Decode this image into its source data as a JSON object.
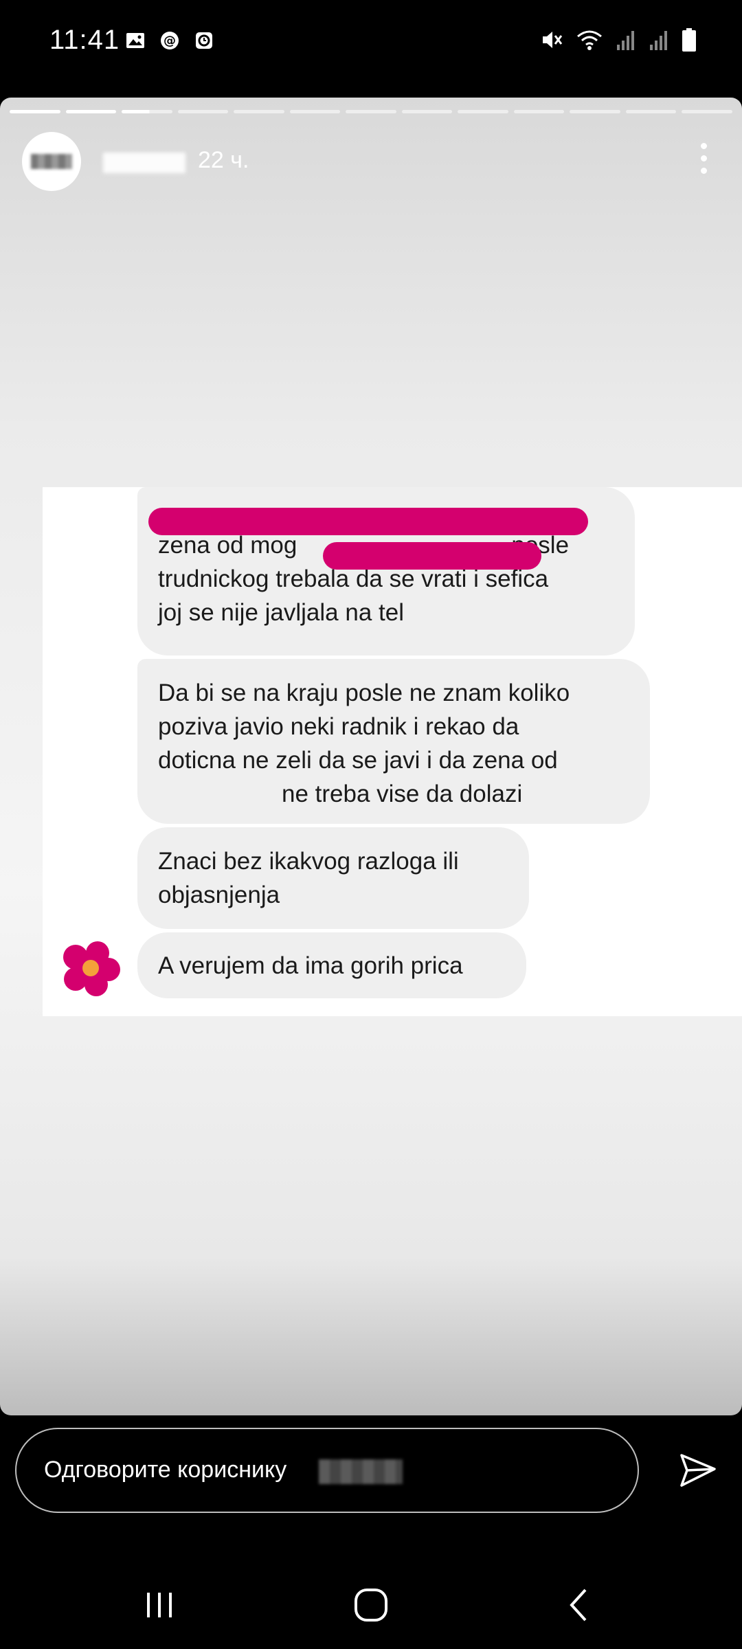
{
  "status_bar": {
    "time": "11:41",
    "left_icons": [
      "image-icon",
      "at-sign-icon",
      "clock-app-icon"
    ],
    "right_icons": [
      "mute-icon",
      "wifi-icon",
      "signal-icon",
      "signal-icon",
      "battery-icon"
    ]
  },
  "story": {
    "segments_total": 13,
    "segments_done": 2,
    "current_segment": 3,
    "time_ago": "22 ч."
  },
  "chat": {
    "messages": [
      {
        "lines": [
          "zena od mog",
          "posle",
          "trudnickog trebala da se vrati i sefica",
          "joj se nije javljala na tel"
        ]
      },
      {
        "lines": [
          "Da bi se na kraju posle ne znam koliko",
          "poziva javio neki radnik i rekao da",
          "doticna ne zeli da se javi i da zena od",
          "ne treba vise da dolazi"
        ]
      },
      {
        "lines": [
          "Znaci bez ikakvog razloga ili",
          "objasnjenja"
        ]
      },
      {
        "lines": [
          "A verujem da ima gorih prica"
        ]
      }
    ],
    "redact_color": "#d4006e"
  },
  "reply": {
    "placeholder": "Одговорите кориснику"
  },
  "nav_icons": [
    "recents-icon",
    "home-icon",
    "back-icon"
  ]
}
